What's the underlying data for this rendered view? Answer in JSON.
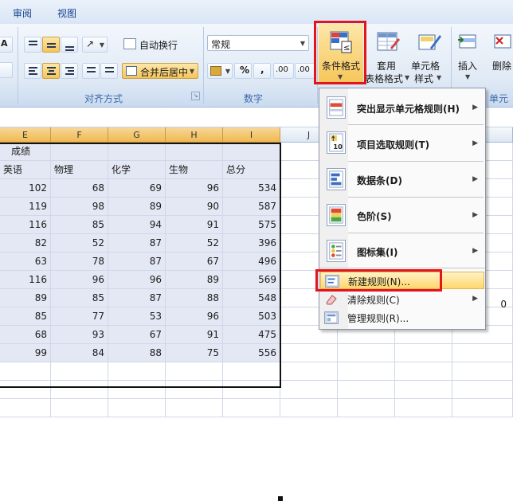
{
  "tabs": {
    "review": "审阅",
    "view": "视图"
  },
  "ribbon": {
    "wrap_text": "自动换行",
    "merge_center": "合并后居中",
    "number_format": "常规",
    "percent": "%",
    "comma": ",",
    "decimals": ".00",
    "conditional_format": "条件格式",
    "format_table_1": "套用",
    "format_table_2": "表格格式",
    "cell_style_1": "单元格",
    "cell_style_2": "样式",
    "insert": "插入",
    "delete": "删除",
    "group_alignment": "对齐方式",
    "group_number": "数字",
    "group_cells": "单元格",
    "font_btn": "A"
  },
  "grid": {
    "columns": [
      "E",
      "F",
      "G",
      "H",
      "I",
      "J"
    ],
    "title_cell": "成绩",
    "headers": [
      "英语",
      "物理",
      "化学",
      "生物",
      "总分"
    ],
    "rows": [
      [
        102,
        68,
        69,
        96,
        534
      ],
      [
        119,
        98,
        89,
        90,
        587
      ],
      [
        116,
        85,
        94,
        91,
        575
      ],
      [
        82,
        52,
        87,
        52,
        396
      ],
      [
        63,
        78,
        87,
        67,
        496
      ],
      [
        116,
        96,
        96,
        89,
        569
      ],
      [
        89,
        85,
        87,
        88,
        548
      ],
      [
        85,
        77,
        53,
        96,
        503
      ],
      [
        68,
        93,
        67,
        91,
        475
      ],
      [
        99,
        84,
        88,
        75,
        556
      ]
    ],
    "stray_value": "0"
  },
  "menu": {
    "items": [
      {
        "label": "突出显示单元格规则(H)",
        "icon": "highlight-rules-icon"
      },
      {
        "label": "项目选取规则(T)",
        "icon": "top-bottom-rules-icon"
      },
      {
        "label": "数据条(D)",
        "icon": "data-bars-icon"
      },
      {
        "label": "色阶(S)",
        "icon": "color-scales-icon"
      },
      {
        "label": "图标集(I)",
        "icon": "icon-sets-icon"
      }
    ],
    "new_rule": "新建规则(N)...",
    "clear_rules": "清除规则(C)",
    "manage_rules": "管理规则(R)...",
    "top10_icon_text": "10"
  },
  "colors": {
    "highlight_red": "#e3141b",
    "header_orange": "#f0b94f",
    "selection": "#e4e8f4"
  }
}
